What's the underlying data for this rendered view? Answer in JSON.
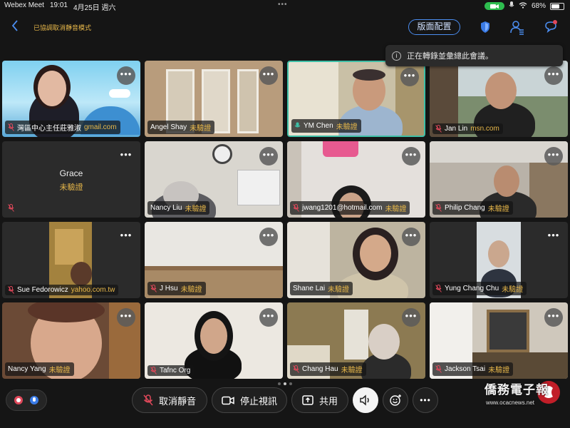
{
  "status_bar": {
    "app": "Webex Meet",
    "time": "19:01",
    "date": "4月25日 週六",
    "battery": "68%",
    "battery_level": 0.68
  },
  "top_bar": {
    "mute_mode_text": "已協調取消靜音模式",
    "layout_button": "版面配置"
  },
  "toast": {
    "text": "正在轉錄並彙總此會議。"
  },
  "participants": [
    {
      "name": "灣區中心主任莊雅淑",
      "suffix": "gmail.com",
      "mic": "muted"
    },
    {
      "name": "Angel Shay",
      "suffix": "未驗證",
      "mic": "none"
    },
    {
      "name": "YM Chen",
      "suffix": "未驗證",
      "mic": "on"
    },
    {
      "name": "Jan Lin",
      "suffix": "msn.com",
      "mic": "muted"
    },
    {
      "name": "Grace",
      "suffix": "未驗證",
      "mic": "muted"
    },
    {
      "name": "Nancy Liu",
      "suffix": "未驗證",
      "mic": "none"
    },
    {
      "name": "jwang1201@hotmail.com",
      "suffix": "未驗證",
      "mic": "muted"
    },
    {
      "name": "Philip Chang",
      "suffix": "未驗證",
      "mic": "muted"
    },
    {
      "name": "Sue Fedorowicz",
      "suffix": "yahoo.com.tw",
      "mic": "muted"
    },
    {
      "name": "J Hsu",
      "suffix": "未驗證",
      "mic": "muted"
    },
    {
      "name": "Shane Lai",
      "suffix": "未驗證",
      "mic": "none"
    },
    {
      "name": "Yung Chang Chu",
      "suffix": "未驗證",
      "mic": "muted"
    },
    {
      "name": "Nancy Yang",
      "suffix": "未驗證",
      "mic": "none"
    },
    {
      "name": "Tafnc Org",
      "suffix": "",
      "mic": "muted"
    },
    {
      "name": "Chang Hau",
      "suffix": "未驗證",
      "mic": "muted"
    },
    {
      "name": "Jackson Tsai",
      "suffix": "未驗證",
      "mic": "muted"
    }
  ],
  "controls": {
    "unmute": "取消靜音",
    "stop_video": "停止視訊",
    "share": "共用"
  },
  "watermark": {
    "brand": "僑務電子報",
    "url": "www.ocacnews.net"
  },
  "colors": {
    "accent_blue": "#4b8df0",
    "unverified": "#e8b84a",
    "active_speaker": "#3fbfa6",
    "muted_red": "#e0485a"
  }
}
